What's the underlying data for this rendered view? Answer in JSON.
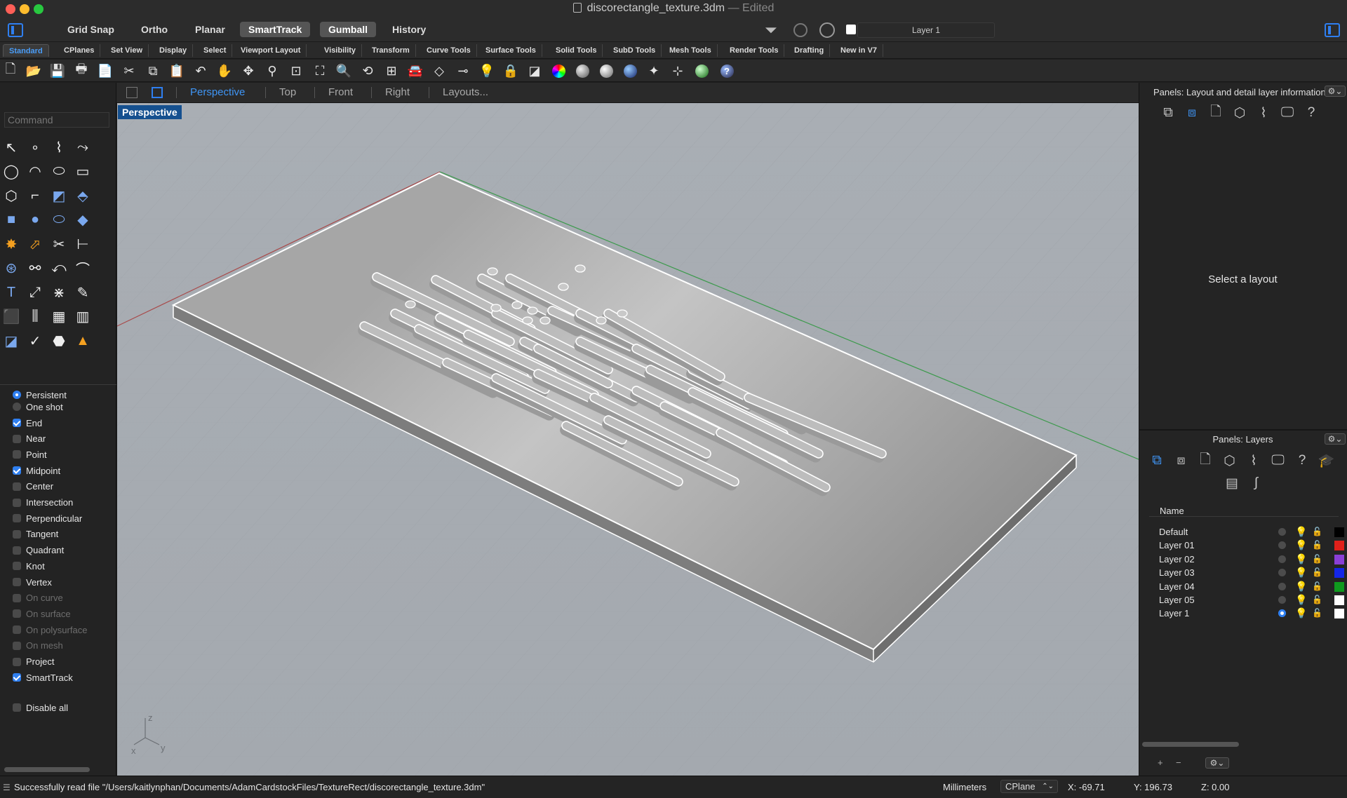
{
  "window": {
    "filename": "discorectangle_texture.3dm",
    "separator": "—",
    "state": "Edited"
  },
  "titlebar": {
    "buttons": [
      {
        "label": "Grid Snap",
        "active": false
      },
      {
        "label": "Ortho",
        "active": false
      },
      {
        "label": "Planar",
        "active": false
      },
      {
        "label": "SmartTrack",
        "active": true
      },
      {
        "label": "Gumball",
        "active": true
      },
      {
        "label": "History",
        "active": false
      }
    ],
    "current_layer": "Layer 1"
  },
  "tabs": [
    "Standard",
    "CPlanes",
    "Set View",
    "Display",
    "Select",
    "Viewport Layout",
    "Visibility",
    "Transform",
    "Curve Tools",
    "Surface Tools",
    "Solid Tools",
    "SubD Tools",
    "Mesh Tools",
    "Render Tools",
    "Drafting",
    "New in V7"
  ],
  "active_tab": "Standard",
  "command": {
    "placeholder": "Command"
  },
  "viewport_tabs": [
    "Perspective",
    "Top",
    "Front",
    "Right",
    "Layouts..."
  ],
  "active_viewport": "Perspective",
  "viewport_label": "Perspective",
  "osnap": {
    "modes": [
      {
        "label": "Persistent",
        "on": true
      },
      {
        "label": "One shot",
        "on": false
      }
    ],
    "items": [
      {
        "label": "End",
        "on": true,
        "enabled": true
      },
      {
        "label": "Near",
        "on": false,
        "enabled": true
      },
      {
        "label": "Point",
        "on": false,
        "enabled": true
      },
      {
        "label": "Midpoint",
        "on": true,
        "enabled": true
      },
      {
        "label": "Center",
        "on": false,
        "enabled": true
      },
      {
        "label": "Intersection",
        "on": false,
        "enabled": true
      },
      {
        "label": "Perpendicular",
        "on": false,
        "enabled": true
      },
      {
        "label": "Tangent",
        "on": false,
        "enabled": true
      },
      {
        "label": "Quadrant",
        "on": false,
        "enabled": true
      },
      {
        "label": "Knot",
        "on": false,
        "enabled": true
      },
      {
        "label": "Vertex",
        "on": false,
        "enabled": true
      },
      {
        "label": "On curve",
        "on": false,
        "enabled": false
      },
      {
        "label": "On surface",
        "on": false,
        "enabled": false
      },
      {
        "label": "On polysurface",
        "on": false,
        "enabled": false
      },
      {
        "label": "On mesh",
        "on": false,
        "enabled": false
      },
      {
        "label": "Project",
        "on": false,
        "enabled": true
      },
      {
        "label": "SmartTrack",
        "on": true,
        "enabled": true
      }
    ],
    "disable_all": "Disable all"
  },
  "panels": {
    "layout_title": "Panels: Layout and detail layer information",
    "layout_message": "Select a layout",
    "layers_title": "Panels: Layers",
    "name_column": "Name",
    "layers": [
      {
        "name": "Default",
        "color": "#000000",
        "current": false
      },
      {
        "name": "Layer 01",
        "color": "#e0201a",
        "current": false
      },
      {
        "name": "Layer 02",
        "color": "#8a3fd6",
        "current": false
      },
      {
        "name": "Layer 03",
        "color": "#1426e8",
        "current": false
      },
      {
        "name": "Layer 04",
        "color": "#0f9a1e",
        "current": false
      },
      {
        "name": "Layer 05",
        "color": "#ffffff",
        "current": false
      },
      {
        "name": "Layer 1",
        "color": "#ffffff",
        "current": true
      }
    ]
  },
  "status": {
    "message": "Successfully read file \"/Users/kaitlynphan/Documents/AdamCardstockFiles/TextureRect/discorectangle_texture.3dm\"",
    "units": "Millimeters",
    "cplane": "CPlane",
    "x": "X: -69.71",
    "y": "Y: 196.73",
    "z": "Z: 0.00"
  },
  "axis_labels": {
    "x": "x",
    "y": "y",
    "z": "z"
  },
  "colors": {
    "accent": "#2f7ff0",
    "viewport_bg": "#a7acb2",
    "label_bg": "#15508f"
  }
}
